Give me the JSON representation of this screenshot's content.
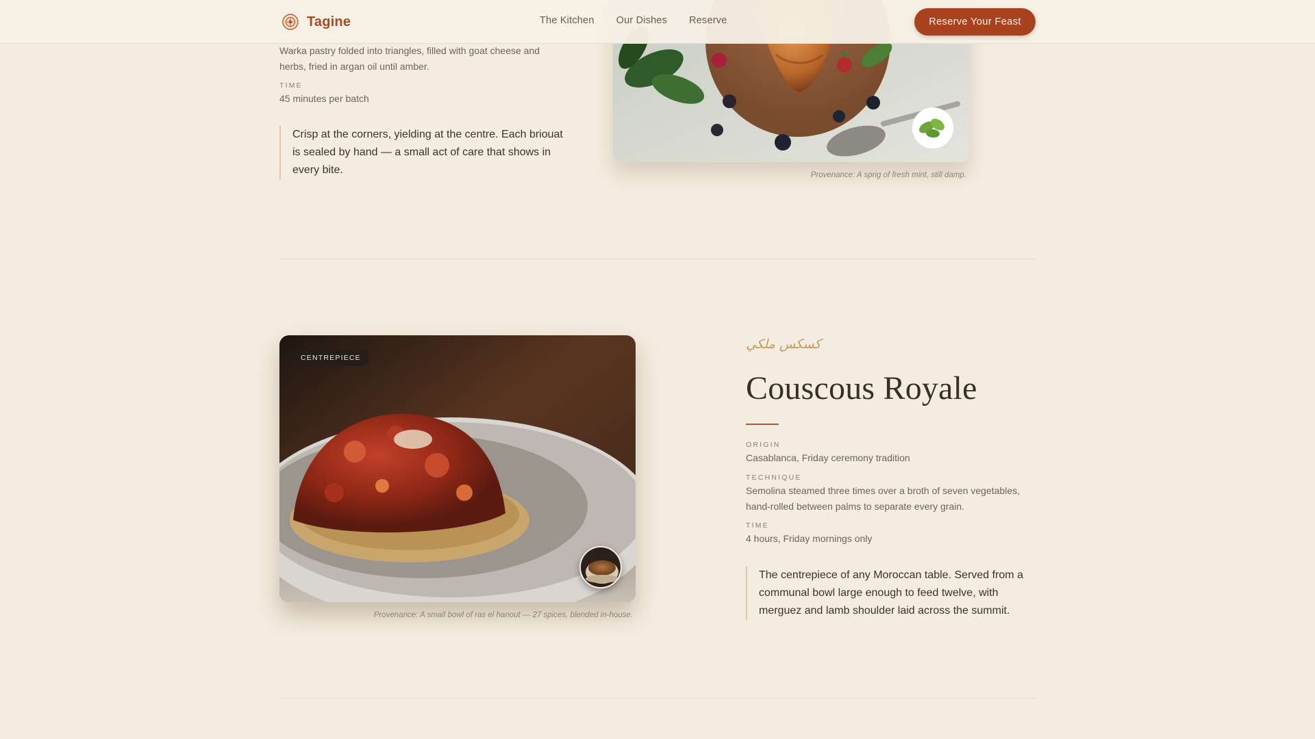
{
  "header": {
    "brand": "Tagine",
    "nav": [
      "The Kitchen",
      "Our Dishes",
      "Reserve"
    ],
    "cta": "Reserve Your Feast"
  },
  "dish1": {
    "description": "Warka pastry folded into triangles, filled with goat cheese and herbs, fried in argan oil until amber.",
    "time_label": "TIME",
    "time": "45 minutes per batch",
    "quote": "Crisp at the corners, yielding at the centre. Each briouat is sealed by hand — a small act of care that shows in every bite.",
    "caption": "Provenance: A sprig of fresh mint, still damp."
  },
  "dish2": {
    "tag": "CENTREPIECE",
    "arabic": "كسكس ملكي",
    "title": "Couscous Royale",
    "origin_label": "ORIGIN",
    "origin": "Casablanca, Friday ceremony tradition",
    "technique_label": "TECHNIQUE",
    "technique": "Semolina steamed three times over a broth of seven vegetables, hand-rolled between palms to separate every grain.",
    "time_label": "TIME",
    "time": "4 hours, Friday mornings only",
    "quote": "The centrepiece of any Moroccan table. Served from a communal bowl large enough to feed twelve, with merguez and lamb shoulder laid across the summit.",
    "caption": "Provenance: A small bowl of ras el hanout — 27 spices, blended in-house."
  },
  "colors": {
    "background": "#f4ece0",
    "accent": "#a9421e",
    "gold": "#c39c5c"
  }
}
